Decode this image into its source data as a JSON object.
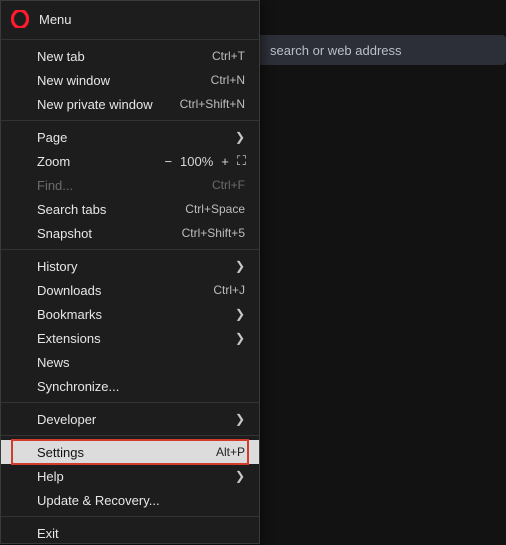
{
  "background": {
    "search_placeholder": "search or web address"
  },
  "menu": {
    "title": "Menu",
    "groups": [
      [
        {
          "label": "New tab",
          "shortcut": "Ctrl+T"
        },
        {
          "label": "New window",
          "shortcut": "Ctrl+N"
        },
        {
          "label": "New private window",
          "shortcut": "Ctrl+Shift+N"
        }
      ],
      [
        {
          "label": "Page",
          "submenu": true
        },
        {
          "type": "zoom",
          "label": "Zoom",
          "minus": "−",
          "value": "100%",
          "plus": "+",
          "fs": "⛶"
        },
        {
          "label": "Find...",
          "shortcut": "Ctrl+F",
          "disabled": true
        },
        {
          "label": "Search tabs",
          "shortcut": "Ctrl+Space"
        },
        {
          "label": "Snapshot",
          "shortcut": "Ctrl+Shift+5"
        }
      ],
      [
        {
          "label": "History",
          "submenu": true
        },
        {
          "label": "Downloads",
          "shortcut": "Ctrl+J"
        },
        {
          "label": "Bookmarks",
          "submenu": true
        },
        {
          "label": "Extensions",
          "submenu": true
        },
        {
          "label": "News"
        },
        {
          "label": "Synchronize..."
        }
      ],
      [
        {
          "label": "Developer",
          "submenu": true
        }
      ],
      [
        {
          "label": "Settings",
          "shortcut": "Alt+P",
          "highlight": true
        },
        {
          "label": "Help",
          "submenu": true
        },
        {
          "label": "Update & Recovery..."
        }
      ],
      [
        {
          "label": "Exit"
        }
      ]
    ]
  }
}
